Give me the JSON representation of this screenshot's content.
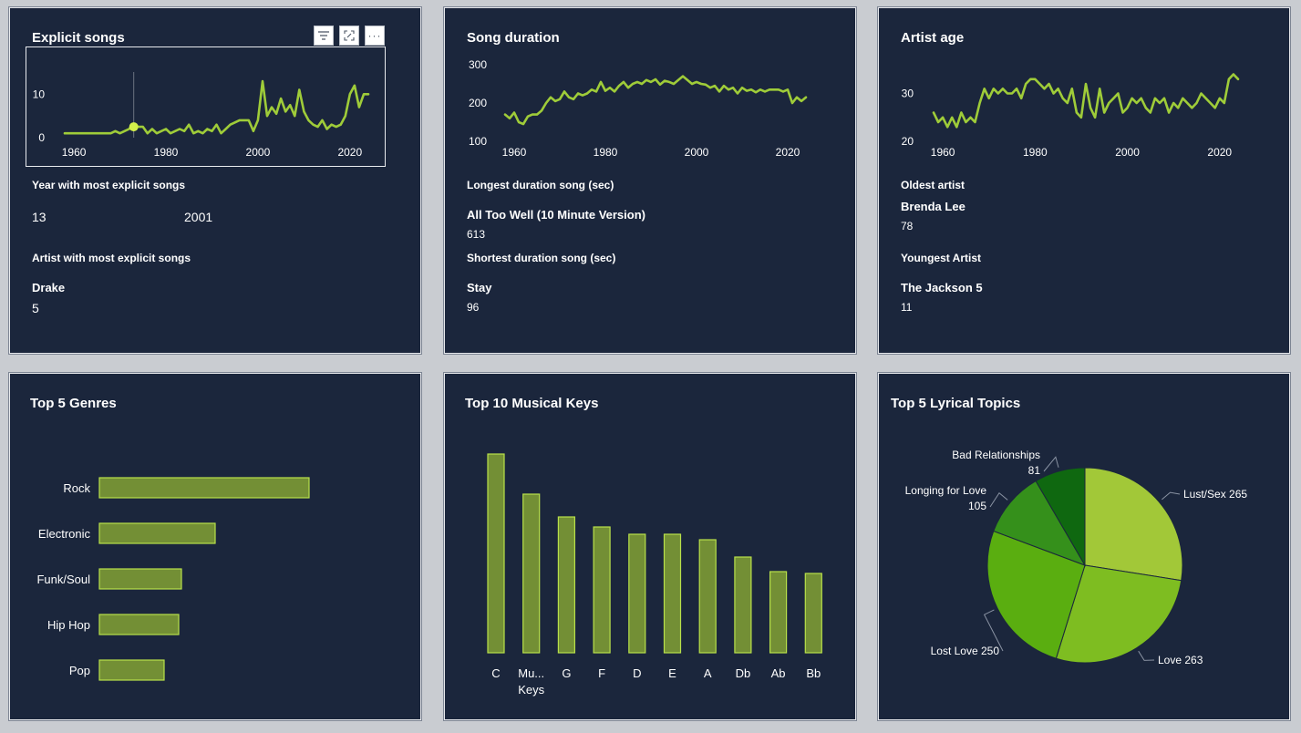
{
  "colors": {
    "card_bg": "#1b263c",
    "line": "#9fcc39",
    "bar_fill": "#738f35",
    "bar_stroke": "#b8e04a",
    "pie": [
      "#a2c838",
      "#7ebd21",
      "#5aae10",
      "#35901b",
      "#0f6810"
    ]
  },
  "explicit": {
    "title": "Explicit songs",
    "label_year": "Year with most explicit songs",
    "year_count": "13",
    "year_value": "2001",
    "label_artist": "Artist with most explicit songs",
    "artist_name": "Drake",
    "artist_count": "5",
    "toolbar": {
      "filter_icon": "filter-icon",
      "focus_icon": "focus-mode-icon",
      "more_icon": "more-options-icon"
    }
  },
  "duration": {
    "title": "Song duration",
    "label_longest": "Longest duration song (sec)",
    "longest_name": "All Too Well (10 Minute Version)",
    "longest_value": "613",
    "label_shortest": "Shortest duration song (sec)",
    "shortest_name": "Stay",
    "shortest_value": "96"
  },
  "age": {
    "title": "Artist age",
    "label_oldest": "Oldest artist",
    "oldest_name": "Brenda Lee",
    "oldest_value": "78",
    "label_youngest": "Youngest Artist",
    "youngest_name": "The Jackson 5",
    "youngest_value": "11"
  },
  "genres": {
    "title": "Top 5 Genres"
  },
  "keys": {
    "title": "Top 10 Musical Keys"
  },
  "topics": {
    "title": "Top 5 Lyrical Topics"
  },
  "chart_data": [
    {
      "id": "explicit",
      "type": "line",
      "xlim": [
        1958,
        2024
      ],
      "ylim": [
        0,
        13
      ],
      "x_ticks": [
        "1960",
        "1980",
        "2000",
        "2020"
      ],
      "y_ticks": [
        "0",
        "10"
      ],
      "x": [
        1958,
        1960,
        1962,
        1964,
        1966,
        1968,
        1969,
        1970,
        1971,
        1972,
        1973,
        1974,
        1975,
        1976,
        1977,
        1978,
        1979,
        1980,
        1981,
        1982,
        1983,
        1984,
        1985,
        1986,
        1987,
        1988,
        1989,
        1990,
        1991,
        1992,
        1993,
        1994,
        1995,
        1996,
        1997,
        1998,
        1999,
        2000,
        2001,
        2002,
        2003,
        2004,
        2005,
        2006,
        2007,
        2008,
        2009,
        2010,
        2011,
        2012,
        2013,
        2014,
        2015,
        2016,
        2017,
        2018,
        2019,
        2020,
        2021,
        2022,
        2023,
        2024
      ],
      "y": [
        1,
        1,
        1,
        1,
        1,
        1,
        1.5,
        1,
        1.5,
        2,
        3,
        2.5,
        2.5,
        1,
        2,
        1,
        1.5,
        2,
        1,
        1.5,
        2,
        1.5,
        3,
        1,
        1.5,
        1,
        2,
        1.5,
        3,
        1,
        2,
        3,
        3.5,
        4,
        4,
        4,
        1.5,
        4,
        13,
        5,
        7,
        5.5,
        9,
        6,
        7.5,
        5,
        11,
        6,
        4,
        3,
        2.5,
        4,
        2,
        3,
        2.5,
        3,
        5,
        10,
        12,
        7,
        10,
        10
      ],
      "highlight": {
        "x": 1973,
        "y": 2.5
      }
    },
    {
      "id": "duration",
      "type": "line",
      "xlim": [
        1958,
        2024
      ],
      "ylim": [
        100,
        300
      ],
      "x_ticks": [
        "1960",
        "1980",
        "2000",
        "2020"
      ],
      "y_ticks": [
        "100",
        "200",
        "300"
      ],
      "x": [
        1958,
        1959,
        1960,
        1961,
        1962,
        1963,
        1964,
        1965,
        1966,
        1967,
        1968,
        1969,
        1970,
        1971,
        1972,
        1973,
        1974,
        1975,
        1976,
        1977,
        1978,
        1979,
        1980,
        1981,
        1982,
        1983,
        1984,
        1985,
        1986,
        1987,
        1988,
        1989,
        1990,
        1991,
        1992,
        1993,
        1994,
        1995,
        1996,
        1997,
        1998,
        1999,
        2000,
        2001,
        2002,
        2003,
        2004,
        2005,
        2006,
        2007,
        2008,
        2009,
        2010,
        2011,
        2012,
        2013,
        2014,
        2015,
        2016,
        2017,
        2018,
        2019,
        2020,
        2021,
        2022,
        2023,
        2024
      ],
      "y": [
        170,
        160,
        175,
        150,
        145,
        165,
        170,
        170,
        180,
        200,
        215,
        205,
        210,
        230,
        215,
        210,
        225,
        220,
        225,
        235,
        230,
        255,
        232,
        240,
        230,
        245,
        255,
        240,
        250,
        255,
        250,
        260,
        255,
        262,
        248,
        258,
        255,
        250,
        260,
        270,
        260,
        250,
        255,
        250,
        248,
        240,
        245,
        230,
        245,
        235,
        240,
        225,
        240,
        232,
        235,
        228,
        235,
        230,
        235,
        235,
        235,
        230,
        235,
        200,
        215,
        205,
        215
      ]
    },
    {
      "id": "age",
      "type": "line",
      "xlim": [
        1958,
        2024
      ],
      "ylim": [
        20,
        36
      ],
      "x_ticks": [
        "1960",
        "1980",
        "2000",
        "2020"
      ],
      "y_ticks": [
        "20",
        "30"
      ],
      "x": [
        1958,
        1959,
        1960,
        1961,
        1962,
        1963,
        1964,
        1965,
        1966,
        1967,
        1968,
        1969,
        1970,
        1971,
        1972,
        1973,
        1974,
        1975,
        1976,
        1977,
        1978,
        1979,
        1980,
        1981,
        1982,
        1983,
        1984,
        1985,
        1986,
        1987,
        1988,
        1989,
        1990,
        1991,
        1992,
        1993,
        1994,
        1995,
        1996,
        1997,
        1998,
        1999,
        2000,
        2001,
        2002,
        2003,
        2004,
        2005,
        2006,
        2007,
        2008,
        2009,
        2010,
        2011,
        2012,
        2013,
        2014,
        2015,
        2016,
        2017,
        2018,
        2019,
        2020,
        2021,
        2022,
        2023,
        2024
      ],
      "y": [
        26,
        24,
        25,
        23,
        25,
        23,
        26,
        24,
        25,
        24,
        28,
        31,
        29,
        31,
        30,
        31,
        30,
        30,
        31,
        29,
        32,
        33,
        33,
        32,
        31,
        32,
        30,
        31,
        29,
        28,
        31,
        26,
        25,
        32,
        27,
        25,
        31,
        26,
        28,
        29,
        30,
        26,
        27,
        29,
        28,
        29,
        27,
        26,
        29,
        28,
        29,
        26,
        28,
        27,
        29,
        28,
        27,
        28,
        30,
        29,
        28,
        27,
        29,
        28,
        33,
        34,
        33
      ]
    },
    {
      "id": "genres",
      "type": "bar",
      "orientation": "horizontal",
      "categories": [
        "Rock",
        "Electronic",
        "Funk/Soul",
        "Hip Hop",
        "Pop"
      ],
      "values": [
        230,
        127,
        90,
        87,
        71
      ]
    },
    {
      "id": "keys",
      "type": "bar",
      "orientation": "vertical",
      "categories": [
        "C",
        "Mu...",
        "G",
        "F",
        "D",
        "E",
        "A",
        "Db",
        "Ab",
        "Bb"
      ],
      "values": [
        218,
        174,
        149,
        138,
        130,
        130,
        124,
        105,
        89,
        87
      ],
      "xlabel": "Keys"
    },
    {
      "id": "topics",
      "type": "pie",
      "slices": [
        {
          "label": "Lust/Sex",
          "value": 265,
          "text": "Lust/Sex 265"
        },
        {
          "label": "Love",
          "value": 263,
          "text": "Love 263"
        },
        {
          "label": "Lost Love",
          "value": 250,
          "text": "Lost Love 250"
        },
        {
          "label": "Longing for Love",
          "value": 105,
          "text": "105",
          "name_text": "Longing for Love"
        },
        {
          "label": "Bad Relationships",
          "value": 81,
          "text": "81",
          "name_text": "Bad Relationships"
        }
      ]
    }
  ]
}
